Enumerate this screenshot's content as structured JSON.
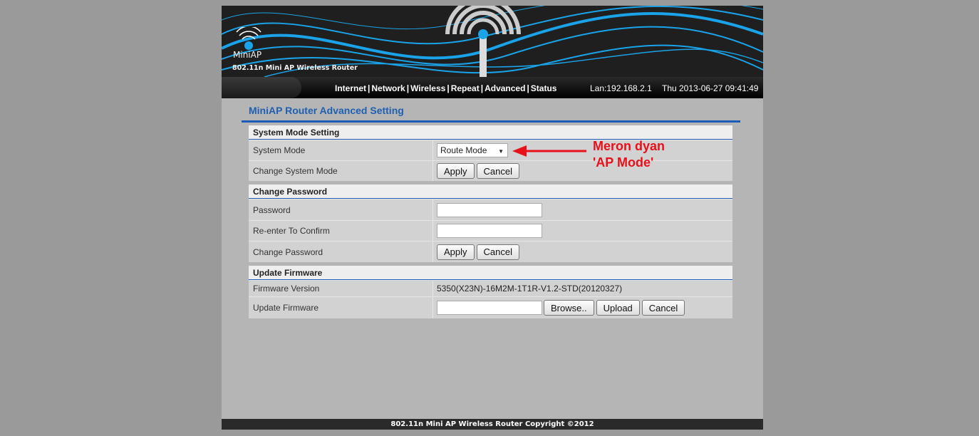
{
  "header": {
    "brand": "MiniAP",
    "subtitle": "802.11n Mini AP Wireless Router"
  },
  "nav": {
    "items": [
      "Internet",
      "Network",
      "Wireless",
      "Repeat",
      "Advanced",
      "Status"
    ],
    "separator": "|",
    "lan": "Lan:192.168.2.1",
    "datetime": "Thu 2013-06-27 09:41:49"
  },
  "page": {
    "title": "MiniAP Router Advanced Setting"
  },
  "system_mode": {
    "heading": "System Mode Setting",
    "mode_label": "System Mode",
    "mode_value": "Route Mode",
    "change_label": "Change System Mode",
    "apply": "Apply",
    "cancel": "Cancel"
  },
  "password": {
    "heading": "Change Password",
    "password_label": "Password",
    "password_value": "",
    "confirm_label": "Re-enter To Confirm",
    "confirm_value": "",
    "change_label": "Change Password",
    "apply": "Apply",
    "cancel": "Cancel"
  },
  "firmware": {
    "heading": "Update Firmware",
    "version_label": "Firmware Version",
    "version_value": "5350(X23N)-16M2M-1T1R-V1.2-STD(20120327)",
    "update_label": "Update Firmware",
    "file_value": "",
    "browse": "Browse..",
    "upload": "Upload",
    "cancel": "Cancel"
  },
  "annotation": {
    "line1": "Meron dyan",
    "line2": "'AP Mode'",
    "color": "#e8101a"
  },
  "footer": {
    "text": "802.11n Mini AP Wireless Router Copyright ©2012"
  },
  "colors": {
    "accent": "#1a5cb8",
    "header_bg": "#1f1f1f",
    "wave": "#1aa3e8"
  }
}
